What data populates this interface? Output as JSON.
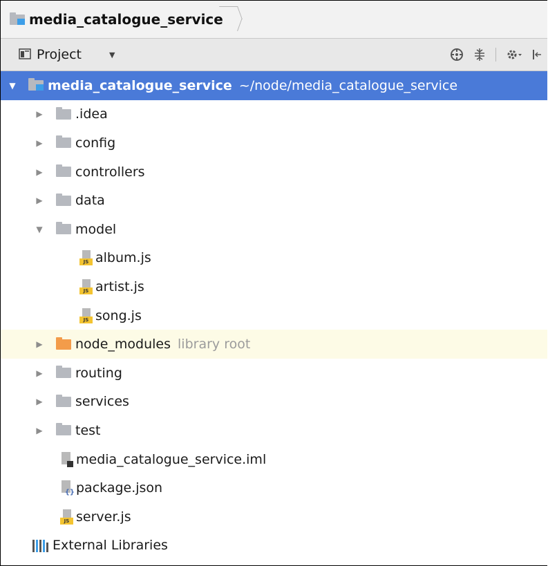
{
  "breadcrumb": {
    "label": "media_catalogue_service"
  },
  "toolbar": {
    "project_label": "Project",
    "dropdown_glyph": "▼"
  },
  "tree": {
    "root": {
      "name": "media_catalogue_service",
      "path": "~/node/media_catalogue_service",
      "expanded": true
    },
    "items": [
      {
        "name": ".idea",
        "type": "folder",
        "expanded": false
      },
      {
        "name": "config",
        "type": "folder",
        "expanded": false
      },
      {
        "name": "controllers",
        "type": "folder",
        "expanded": false
      },
      {
        "name": "data",
        "type": "folder",
        "expanded": false
      },
      {
        "name": "model",
        "type": "folder",
        "expanded": true
      },
      {
        "name": "album.js",
        "type": "js-file"
      },
      {
        "name": "artist.js",
        "type": "js-file"
      },
      {
        "name": "song.js",
        "type": "js-file"
      },
      {
        "name": "node_modules",
        "type": "library-folder",
        "hint": "library root",
        "expanded": false
      },
      {
        "name": "routing",
        "type": "folder",
        "expanded": false
      },
      {
        "name": "services",
        "type": "folder",
        "expanded": false
      },
      {
        "name": "test",
        "type": "folder",
        "expanded": false
      },
      {
        "name": "media_catalogue_service.iml",
        "type": "iml-file"
      },
      {
        "name": "package.json",
        "type": "json-file"
      },
      {
        "name": "server.js",
        "type": "js-file"
      }
    ],
    "external": {
      "name": "External Libraries"
    }
  },
  "icons": {
    "js_badge": "JS",
    "json_badge": "{}",
    "collapsed_arrow": "▶",
    "expanded_arrow": "▼"
  },
  "colors": {
    "selection": "#4a7ad8",
    "library_row": "#fdfbe6",
    "folder": "#b6b9bf",
    "library_folder": "#f39c4a",
    "js_badge": "#f4c431",
    "hint_text": "#9c9c9c"
  }
}
